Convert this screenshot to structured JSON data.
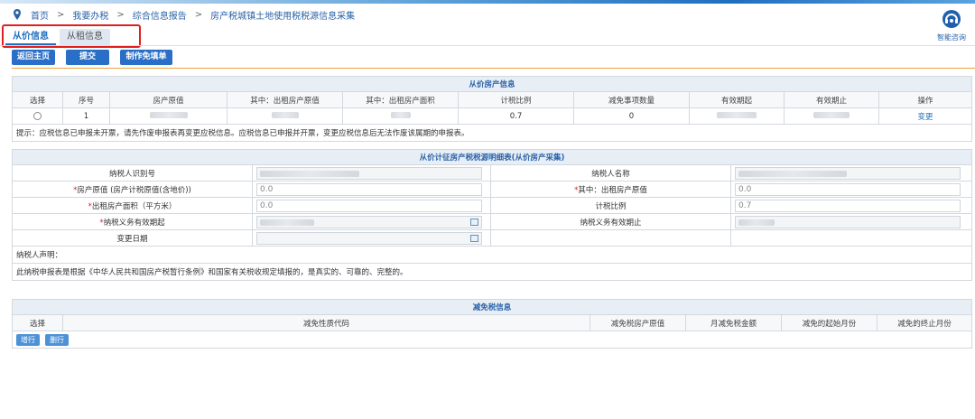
{
  "breadcrumb": {
    "items": [
      "首页",
      "我要办税",
      "综合信息报告",
      "房产税城镇土地使用税税源信息采集"
    ],
    "separator": ">"
  },
  "assistant": {
    "label": "智能咨询",
    "icon": "headset-icon"
  },
  "tabs": [
    {
      "label": "从价信息",
      "active": true
    },
    {
      "label": "从租信息",
      "active": false
    }
  ],
  "toolbar": {
    "back_label": "返回主页",
    "submit_label": "提交",
    "exempt_label": "制作免填单"
  },
  "section1": {
    "title": "从价房产信息",
    "headers": [
      "选择",
      "序号",
      "房产原值",
      "其中：出租房产原值",
      "其中：出租房产面积",
      "计税比例",
      "减免事项数量",
      "有效期起",
      "有效期止",
      "操作"
    ],
    "row": {
      "index": "1",
      "ratio": "0.7",
      "relief_count": "0",
      "action": "变更"
    },
    "tip": "提示：应税信息已申报未开票，请先作废申报表再变更应税信息。应税信息已申报并开票，变更应税信息后无法作废该属期的申报表。"
  },
  "section2": {
    "title": "从价计征房产税税源明细表(从价房产采集)",
    "taxpayer_id_label": "纳税人识别号",
    "taxpayer_name_label": "纳税人名称",
    "original_value_label": "房产原值 (房产计税原值(含地价))",
    "original_value": "0.0",
    "rent_original_label": "其中：出租房产原值",
    "rent_original_value": "0.0",
    "rent_area_label": "出租房产面积（平方米）",
    "rent_area_value": "0.0",
    "ratio_label": "计税比例",
    "ratio_value": "0.7",
    "obligation_start_label": "纳税义务有效期起",
    "obligation_end_label": "纳税义务有效期止",
    "change_date_label": "变更日期",
    "required_mark": "*",
    "declaration_title": "纳税人声明：",
    "declaration_text": "此纳税申报表是根据《中华人民共和国房产税暂行条例》和国家有关税收规定填报的，是真实的、可靠的、完整的。"
  },
  "section3": {
    "title": "减免税信息",
    "headers": [
      "选择",
      "减免性质代码",
      "减免税房产原值",
      "月减免税金额",
      "减免的起始月份",
      "减免的终止月份"
    ],
    "add_label": "增行",
    "delete_label": "删行"
  },
  "colors": {
    "accent": "#2a6fc7",
    "highlight": "#e02020",
    "divider": "#f0a040"
  }
}
